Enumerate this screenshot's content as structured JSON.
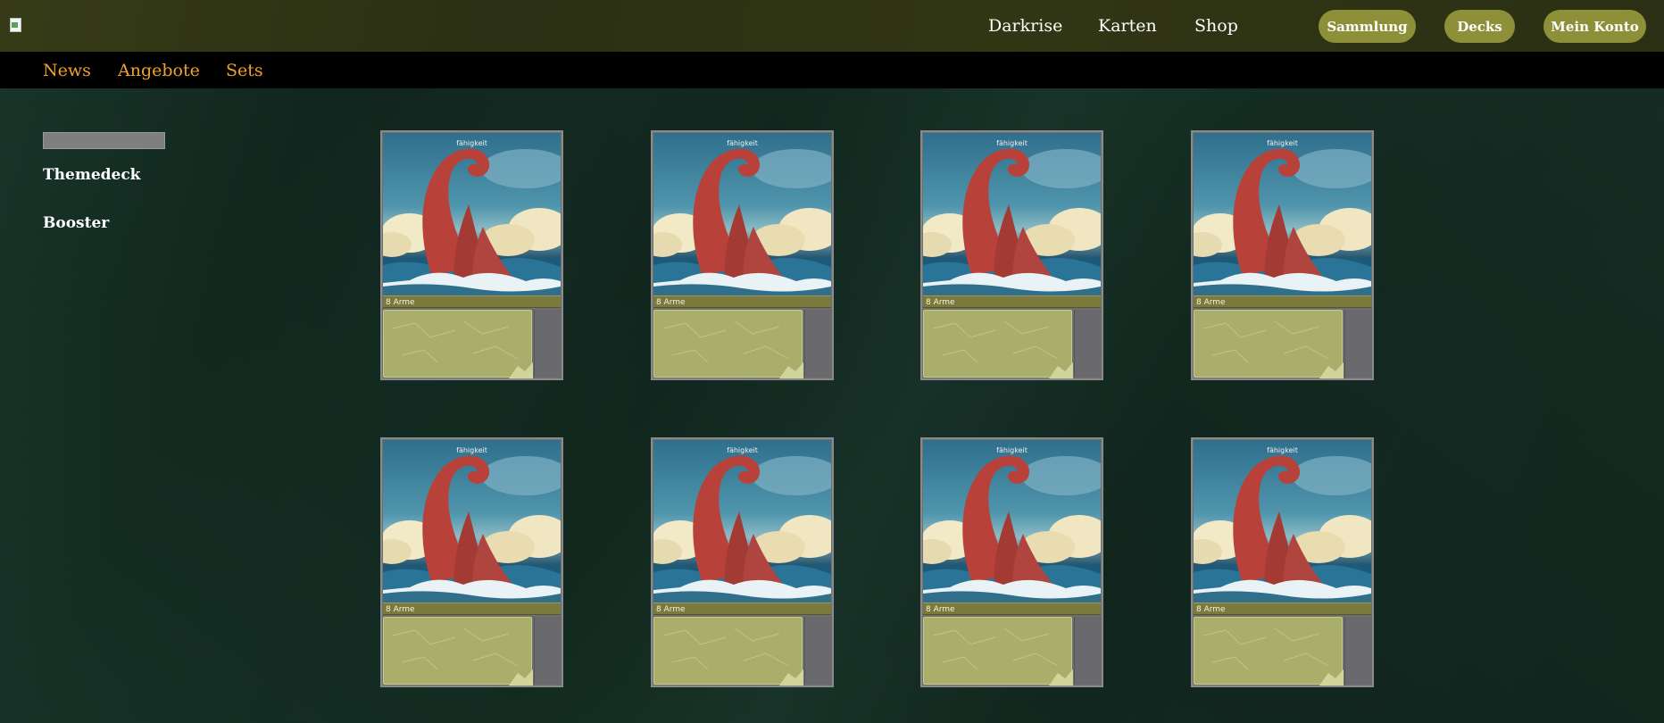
{
  "header": {
    "nav": [
      "Darkrise",
      "Karten",
      "Shop"
    ],
    "buttons": [
      "Sammlung",
      "Decks",
      "Mein Konto"
    ],
    "button_color": "#8d9038"
  },
  "subnav": {
    "items": [
      "News",
      "Angebote",
      "Sets"
    ],
    "color": "#f0a12a"
  },
  "sidebar": {
    "items": [
      "Themedeck",
      "Booster"
    ]
  },
  "cards": [
    {
      "ability": "fähigkeit",
      "name": "8 Arme"
    },
    {
      "ability": "fähigkeit",
      "name": "8 Arme"
    },
    {
      "ability": "fähigkeit",
      "name": "8 Arme"
    },
    {
      "ability": "fähigkeit",
      "name": "8 Arme"
    },
    {
      "ability": "fähigkeit",
      "name": "8 Arme"
    },
    {
      "ability": "fähigkeit",
      "name": "8 Arme"
    },
    {
      "ability": "fähigkeit",
      "name": "8 Arme"
    },
    {
      "ability": "fähigkeit",
      "name": "8 Arme"
    }
  ]
}
